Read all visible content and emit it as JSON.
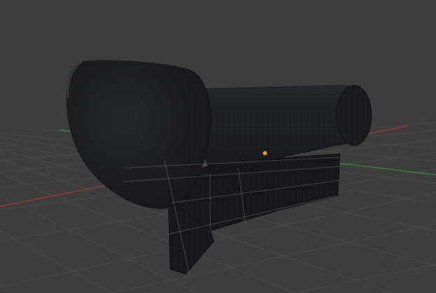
{
  "viewport": {
    "background": "#3d3d3d",
    "grid_color": "#4a4a4a",
    "grid_visible": true
  },
  "axes": {
    "x_axis_color": "#9c3b3b",
    "y_axis_color": "#3a8f3a"
  },
  "object": {
    "material": "dark-stone-texture",
    "base_color": "#1c1e22",
    "highlight_color": "#2f3238"
  },
  "origin": {
    "color": "#f0a040",
    "selected": true
  }
}
